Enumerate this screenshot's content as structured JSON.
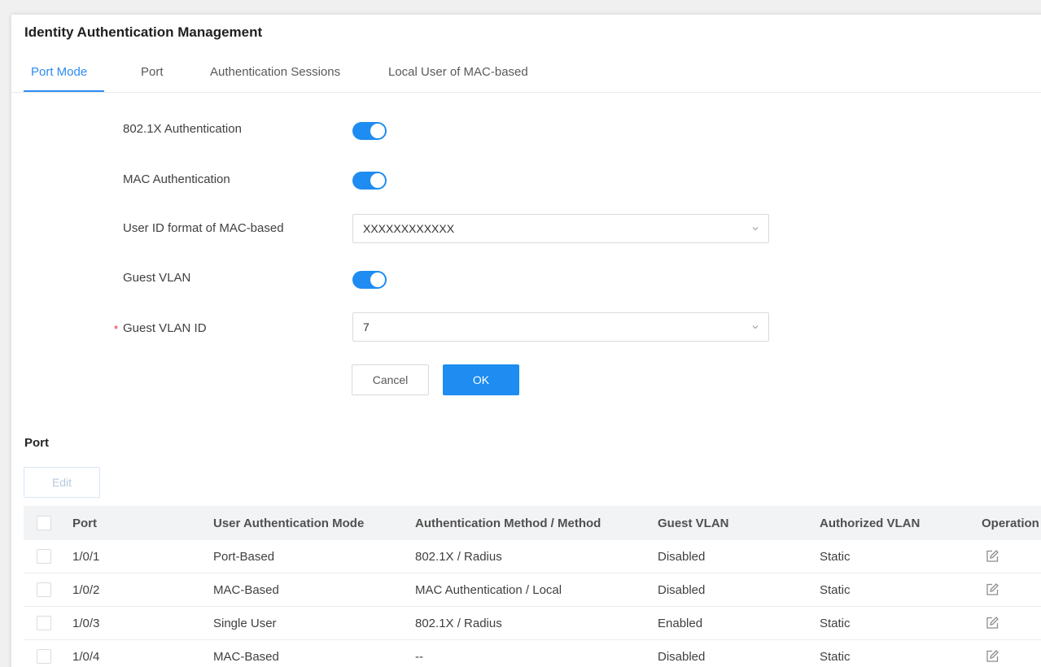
{
  "page": {
    "title": "Identity Authentication Management"
  },
  "tabs": [
    {
      "label": "Port Mode",
      "active": true
    },
    {
      "label": "Port",
      "active": false
    },
    {
      "label": "Authentication Sessions",
      "active": false
    },
    {
      "label": "Local User of MAC-based",
      "active": false
    }
  ],
  "form": {
    "dot1x_label": "802.1X Authentication",
    "dot1x_enabled": true,
    "mac_label": "MAC Authentication",
    "mac_enabled": true,
    "user_id_format_label": "User ID format of MAC-based",
    "user_id_format_value": "XXXXXXXXXXXX",
    "guest_vlan_label": "Guest VLAN",
    "guest_vlan_enabled": true,
    "required_mark": "*",
    "guest_vlan_id_label": "Guest VLAN ID",
    "guest_vlan_id_value": "7",
    "cancel_label": "Cancel",
    "ok_label": "OK"
  },
  "port_section": {
    "title": "Port",
    "edit_label": "Edit",
    "columns": [
      "Port",
      "User Authentication Mode",
      "Authentication Method / Method",
      "Guest VLAN",
      "Authorized VLAN",
      "Operation"
    ],
    "rows": [
      {
        "port": "1/0/1",
        "mode": "Port-Based",
        "method": "802.1X / Radius",
        "guest_vlan": "Disabled",
        "authorized_vlan": "Static"
      },
      {
        "port": "1/0/2",
        "mode": "MAC-Based",
        "method": "MAC Authentication / Local",
        "guest_vlan": "Disabled",
        "authorized_vlan": "Static"
      },
      {
        "port": "1/0/3",
        "mode": "Single User",
        "method": "802.1X / Radius",
        "guest_vlan": "Enabled",
        "authorized_vlan": "Static"
      },
      {
        "port": "1/0/4",
        "mode": "MAC-Based",
        "method": "--",
        "guest_vlan": "Disabled",
        "authorized_vlan": "Static"
      }
    ]
  },
  "icons": {
    "dropdown": "chevron-down-icon",
    "row_edit": "edit-icon"
  },
  "colors": {
    "accent": "#1e8cf0",
    "required": "#f5222d"
  }
}
